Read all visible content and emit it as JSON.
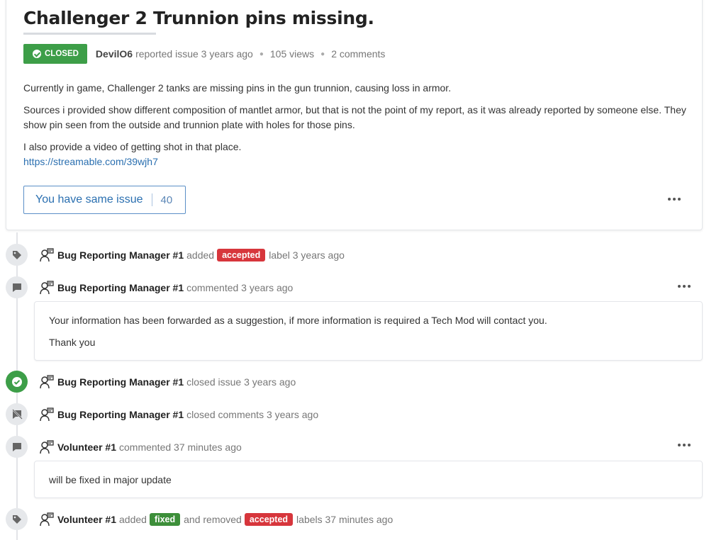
{
  "issue": {
    "title": "Challenger 2 Trunnion pins missing.",
    "status": "CLOSED",
    "author": "DevilO6",
    "reported_text": "reported issue 3 years ago",
    "views": "105 views",
    "comments": "2 comments",
    "paragraphs": [
      "Currently in game, Challenger 2 tanks are missing pins in the gun trunnion, causing loss in armor.",
      "Sources i provided show different composition of mantlet armor, but that is not the point of my report, as it was already reported by someone else. They show pin seen from the outside and trunnion plate with holes for those pins.",
      "I also provide a video of getting shot in that place."
    ],
    "link": "https://streamable.com/39wjh7",
    "same_issue_label": "You have same issue",
    "same_issue_count": "40"
  },
  "timeline": {
    "e1": {
      "icon": "tag-icon",
      "user": "Bug Reporting Manager #1",
      "action": "added",
      "label": "accepted",
      "after": "label 3 years ago"
    },
    "e2": {
      "icon": "comment-icon",
      "user": "Bug Reporting Manager #1",
      "action": "commented 3 years ago",
      "comment": [
        "Your information has been forwarded as a suggestion, if more information is required a Tech Mod will contact you.",
        "Thank you"
      ]
    },
    "e3": {
      "icon": "check-circle-icon",
      "user": "Bug Reporting Manager #1",
      "action": "closed issue 3 years ago"
    },
    "e4": {
      "icon": "comment-off-icon",
      "user": "Bug Reporting Manager #1",
      "action": "closed comments 3 years ago"
    },
    "e5": {
      "icon": "comment-icon",
      "user": "Volunteer #1",
      "action": "commented 37 minutes ago",
      "comment": [
        "will be fixed in major update"
      ]
    },
    "e6": {
      "icon": "tag-icon",
      "user": "Volunteer #1",
      "action": "added",
      "label_added": "fixed",
      "middle": "and removed",
      "label_removed": "accepted",
      "after": "labels 37 minutes ago"
    }
  },
  "colors": {
    "closed_badge": "#3d9e48",
    "label_red": "#d7363c",
    "label_green": "#3d8f3a",
    "link": "#2a6fb0"
  }
}
